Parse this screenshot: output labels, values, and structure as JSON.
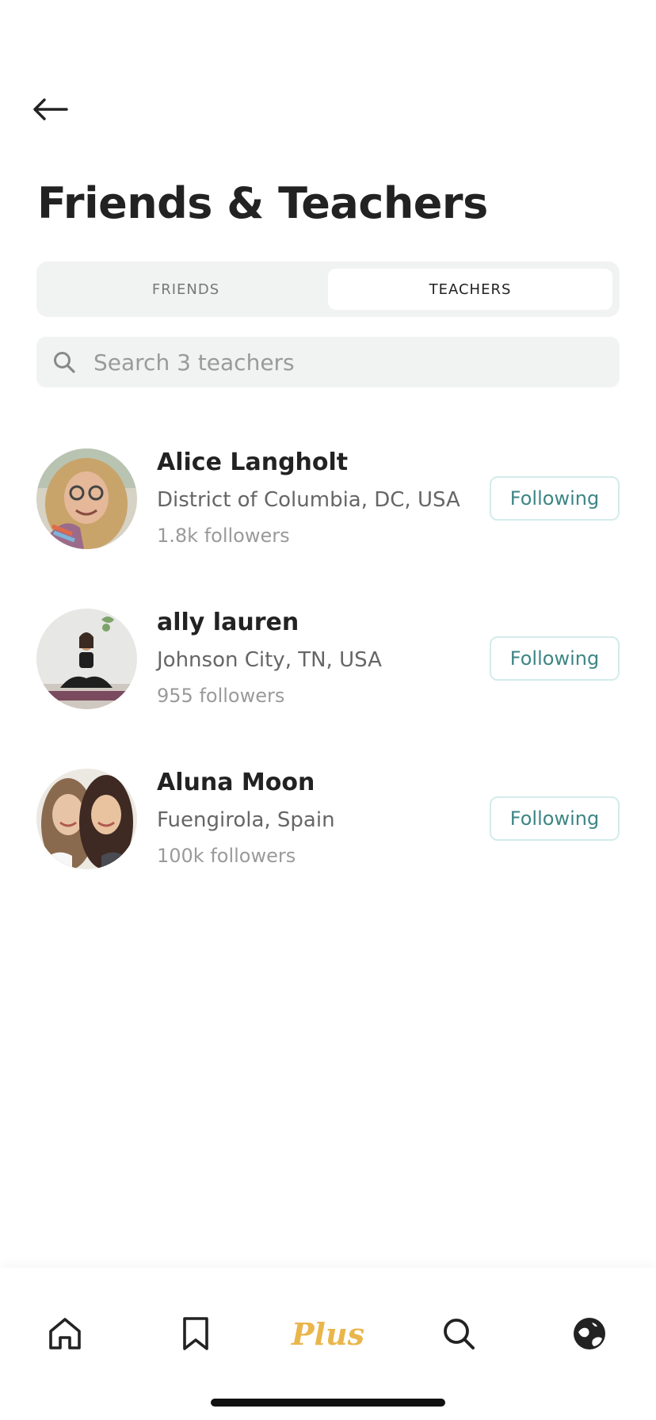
{
  "header": {
    "title": "Friends & Teachers"
  },
  "tabs": [
    {
      "label": "FRIENDS",
      "active": false
    },
    {
      "label": "TEACHERS",
      "active": true
    }
  ],
  "search": {
    "placeholder": "Search 3 teachers",
    "value": ""
  },
  "teachers": [
    {
      "name": "Alice Langholt",
      "location": "District of Columbia, DC, USA",
      "followers": "1.8k followers",
      "button": "Following"
    },
    {
      "name": "ally lauren",
      "location": "Johnson City, TN, USA",
      "followers": "955 followers",
      "button": "Following"
    },
    {
      "name": "Aluna Moon",
      "location": "Fuengirola, Spain",
      "followers": "100k followers",
      "button": "Following"
    }
  ],
  "bottom_nav": {
    "items": [
      {
        "icon": "home-icon",
        "label": ""
      },
      {
        "icon": "bookmark-icon",
        "label": ""
      },
      {
        "icon": "plus-logo",
        "label": "Plus"
      },
      {
        "icon": "search-icon",
        "label": ""
      },
      {
        "icon": "globe-icon",
        "label": ""
      }
    ],
    "active": "Plus"
  },
  "colors": {
    "accent_teal": "#3d8585",
    "button_border": "#d3ebeb",
    "plus_gold": "#e9b64c",
    "segment_bg": "#f1f2f2"
  }
}
